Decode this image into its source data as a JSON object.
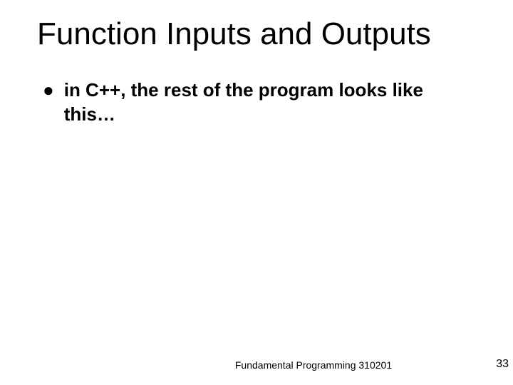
{
  "slide": {
    "title": "Function Inputs and Outputs",
    "bullets": [
      {
        "text": "in C++, the rest of the program looks like this…"
      }
    ],
    "footer": {
      "center": "Fundamental Programming 310201",
      "page": "33"
    }
  }
}
